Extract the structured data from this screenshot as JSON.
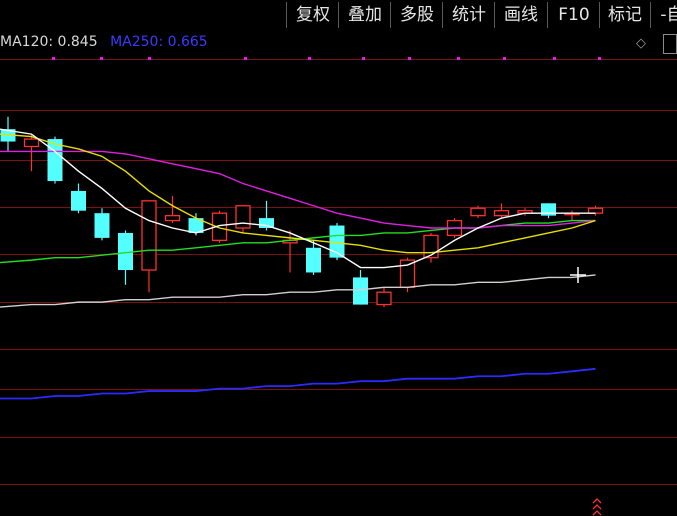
{
  "toolbar": {
    "buttons": [
      {
        "id": "restore-rights",
        "label": "复权"
      },
      {
        "id": "overlay",
        "label": "叠加"
      },
      {
        "id": "multi-stock",
        "label": "多股"
      },
      {
        "id": "statistics",
        "label": "统计"
      },
      {
        "id": "draw-line",
        "label": "画线"
      },
      {
        "id": "f10",
        "label": "F10"
      },
      {
        "id": "mark",
        "label": "标记"
      },
      {
        "id": "self",
        "label": "-自"
      }
    ]
  },
  "indicators": {
    "ma120": {
      "label": "MA120: 0.845",
      "color": "#d8d8d8"
    },
    "ma250": {
      "label": "MA250: 0.665",
      "color": "#3a3aff"
    }
  },
  "colors": {
    "up": "#ff3030",
    "down": "#54ffff",
    "ma5": "#ffffff",
    "ma10": "#e8e000",
    "ma20": "#e020e0",
    "ma60": "#20e020",
    "ma120": "#d0d0d0",
    "ma250": "#2b2bff",
    "grid": "#7a1010"
  },
  "chart_data": {
    "type": "candlestick",
    "candles": [
      {
        "o": 1.42,
        "c": 1.37,
        "h": 1.47,
        "l": 1.33
      },
      {
        "o": 1.35,
        "c": 1.38,
        "h": 1.4,
        "l": 1.25
      },
      {
        "o": 1.38,
        "c": 1.21,
        "h": 1.39,
        "l": 1.2
      },
      {
        "o": 1.17,
        "c": 1.09,
        "h": 1.2,
        "l": 1.08
      },
      {
        "o": 1.08,
        "c": 0.98,
        "h": 1.1,
        "l": 0.97
      },
      {
        "o": 1.0,
        "c": 0.85,
        "h": 1.01,
        "l": 0.79
      },
      {
        "o": 0.85,
        "c": 1.13,
        "h": 1.13,
        "l": 0.76
      },
      {
        "o": 1.05,
        "c": 1.07,
        "h": 1.15,
        "l": 1.04
      },
      {
        "o": 1.06,
        "c": 1.0,
        "h": 1.08,
        "l": 0.99
      },
      {
        "o": 0.97,
        "c": 1.08,
        "h": 1.09,
        "l": 0.96
      },
      {
        "o": 1.02,
        "c": 1.11,
        "h": 1.11,
        "l": 1.0
      },
      {
        "o": 1.06,
        "c": 1.02,
        "h": 1.13,
        "l": 1.01
      },
      {
        "o": 0.96,
        "c": 0.97,
        "h": 1.01,
        "l": 0.84
      },
      {
        "o": 0.94,
        "c": 0.84,
        "h": 0.97,
        "l": 0.83
      },
      {
        "o": 1.03,
        "c": 0.9,
        "h": 1.04,
        "l": 0.89
      },
      {
        "o": 0.82,
        "c": 0.71,
        "h": 0.85,
        "l": 0.71
      },
      {
        "o": 0.71,
        "c": 0.76,
        "h": 0.78,
        "l": 0.7
      },
      {
        "o": 0.78,
        "c": 0.89,
        "h": 0.9,
        "l": 0.76
      },
      {
        "o": 0.9,
        "c": 0.99,
        "h": 1.0,
        "l": 0.88
      },
      {
        "o": 0.99,
        "c": 1.05,
        "h": 1.06,
        "l": 0.98
      },
      {
        "o": 1.07,
        "c": 1.1,
        "h": 1.11,
        "l": 1.06
      },
      {
        "o": 1.07,
        "c": 1.09,
        "h": 1.12,
        "l": 1.06
      },
      {
        "o": 1.08,
        "c": 1.09,
        "h": 1.1,
        "l": 1.07
      },
      {
        "o": 1.12,
        "c": 1.07,
        "h": 1.12,
        "l": 1.06
      },
      {
        "o": 1.08,
        "c": 1.08,
        "h": 1.09,
        "l": 1.05
      },
      {
        "o": 1.08,
        "c": 1.1,
        "h": 1.11,
        "l": 1.07
      }
    ],
    "ma5": [
      1.42,
      1.4,
      1.33,
      1.25,
      1.18,
      1.1,
      1.05,
      1.02,
      1.0,
      1.03,
      1.04,
      1.03,
      1.0,
      0.96,
      0.92,
      0.86,
      0.86,
      0.87,
      0.91,
      0.97,
      1.02,
      1.06,
      1.08,
      1.08,
      1.08,
      1.08
    ],
    "ma10": [
      1.4,
      1.39,
      1.36,
      1.34,
      1.31,
      1.25,
      1.17,
      1.11,
      1.06,
      1.02,
      1.0,
      0.99,
      0.98,
      0.97,
      0.96,
      0.95,
      0.93,
      0.92,
      0.92,
      0.93,
      0.94,
      0.96,
      0.98,
      1.0,
      1.02,
      1.05
    ],
    "ma20": [
      1.33,
      1.33,
      1.33,
      1.33,
      1.33,
      1.32,
      1.3,
      1.28,
      1.26,
      1.24,
      1.2,
      1.17,
      1.14,
      1.11,
      1.08,
      1.06,
      1.04,
      1.03,
      1.02,
      1.02,
      1.02,
      1.03,
      1.03,
      1.03,
      1.04,
      1.05
    ],
    "ma60": [
      0.88,
      0.89,
      0.9,
      0.9,
      0.91,
      0.92,
      0.93,
      0.93,
      0.94,
      0.95,
      0.96,
      0.96,
      0.97,
      0.98,
      0.99,
      0.99,
      1.0,
      1.0,
      1.01,
      1.02,
      1.02,
      1.03,
      1.04,
      1.04,
      1.05,
      1.05
    ],
    "ma120": [
      0.7,
      0.71,
      0.71,
      0.72,
      0.72,
      0.73,
      0.73,
      0.74,
      0.74,
      0.74,
      0.75,
      0.75,
      0.76,
      0.76,
      0.77,
      0.77,
      0.78,
      0.78,
      0.79,
      0.79,
      0.8,
      0.8,
      0.81,
      0.82,
      0.82,
      0.83
    ],
    "ma250": [
      0.33,
      0.33,
      0.34,
      0.34,
      0.35,
      0.35,
      0.36,
      0.36,
      0.36,
      0.37,
      0.37,
      0.38,
      0.38,
      0.39,
      0.39,
      0.4,
      0.4,
      0.41,
      0.41,
      0.41,
      0.42,
      0.42,
      0.43,
      0.43,
      0.44,
      0.45
    ],
    "ylim": [
      0.0,
      1.7
    ]
  }
}
